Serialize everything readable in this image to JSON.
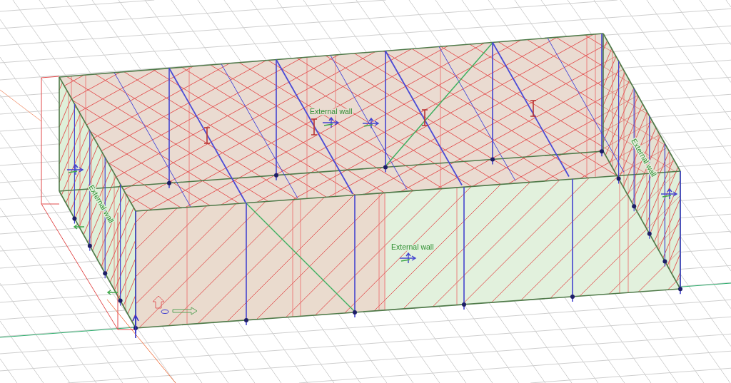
{
  "viewport": {
    "wall_labels": [
      {
        "text": "External wall",
        "kind": "flat"
      },
      {
        "text": "External wall",
        "kind": "slanted"
      },
      {
        "text": "External wall",
        "kind": "slanted"
      },
      {
        "text": "External wall",
        "kind": "flat"
      }
    ]
  }
}
